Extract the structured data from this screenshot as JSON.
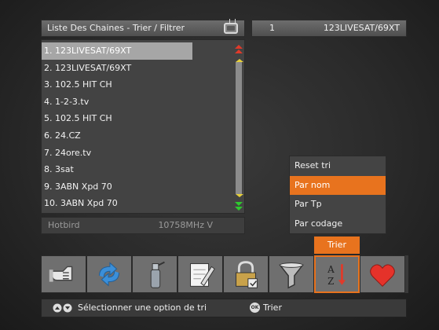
{
  "header": {
    "title": "Liste Des Chaines - Trier / Filtrer",
    "current_number": "1",
    "current_channel": "123LIVESAT/69XT"
  },
  "channels": [
    "1. 123LIVESAT/69XT",
    "2. 123LIVESAT/69XT",
    "3. 102.5 HIT CH",
    "4. 1-2-3.tv",
    "5. 102.5 HIT CH",
    "6. 24.CZ",
    "7. 24ore.tv",
    "8. 3sat",
    "9. 3ABN Xpd 70",
    "10. 3ABN Xpd 70"
  ],
  "selected_index": 0,
  "status": {
    "satellite": "Hotbird",
    "frequency": "10758MHz V"
  },
  "sort_menu": {
    "items": [
      "Reset tri",
      "Par nom",
      "Par Tp",
      "Par codage"
    ],
    "active_index": 1
  },
  "toolbar": {
    "active_label": "Trier",
    "buttons": [
      {
        "icon": "hand-icon"
      },
      {
        "icon": "refresh-arrows-icon"
      },
      {
        "icon": "fire-extinguisher-icon"
      },
      {
        "icon": "pencil-paper-icon"
      },
      {
        "icon": "lock-icon"
      },
      {
        "icon": "funnel-filter-icon"
      },
      {
        "icon": "sort-az-icon"
      },
      {
        "icon": "heart-icon"
      }
    ]
  },
  "help": {
    "text_select": "Sélectionner une option de tri",
    "ok_badge": "OK",
    "text_action": "Trier"
  },
  "colors": {
    "accent": "#e8731e",
    "selected_row": "#a6a6a6",
    "panel": "#434343"
  }
}
